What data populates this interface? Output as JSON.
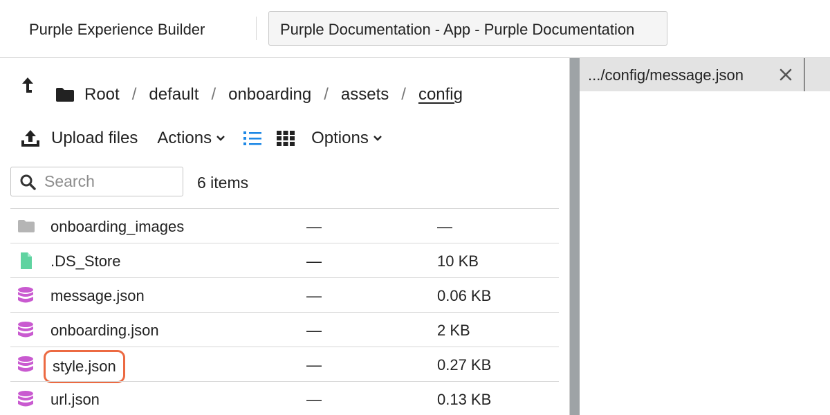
{
  "topbar": {
    "app_title": "Purple Experience Builder",
    "doc_tab": "Purple Documentation - App - Purple Documentation"
  },
  "breadcrumb": {
    "items": [
      "Root",
      "default",
      "onboarding",
      "assets",
      "config"
    ],
    "separator": "/"
  },
  "toolbar": {
    "upload_label": "Upload files",
    "actions_label": "Actions",
    "options_label": "Options",
    "active_view": "list",
    "accent_color": "#1e88e5"
  },
  "search": {
    "placeholder": "Search",
    "value": ""
  },
  "item_count": "6 items",
  "files": [
    {
      "name": "onboarding_images",
      "modified": "—",
      "size": "—",
      "icon": "folder-icon"
    },
    {
      "name": ".DS_Store",
      "modified": "—",
      "size": "10 KB",
      "icon": "file-icon"
    },
    {
      "name": "message.json",
      "modified": "—",
      "size": "0.06 KB",
      "icon": "database-icon"
    },
    {
      "name": "onboarding.json",
      "modified": "—",
      "size": "2 KB",
      "icon": "database-icon"
    },
    {
      "name": "style.json",
      "modified": "—",
      "size": "0.27 KB",
      "icon": "database-icon",
      "highlighted": true
    },
    {
      "name": "url.json",
      "modified": "—",
      "size": "0.13 KB",
      "icon": "database-icon"
    }
  ],
  "preview": {
    "tab_title": ".../config/message.json"
  },
  "colors": {
    "folder": "#b5b5b5",
    "file": "#5fd3a0",
    "database": "#c95ad0",
    "highlight": "#ec6a42",
    "splitter": "#9ea3a6"
  }
}
